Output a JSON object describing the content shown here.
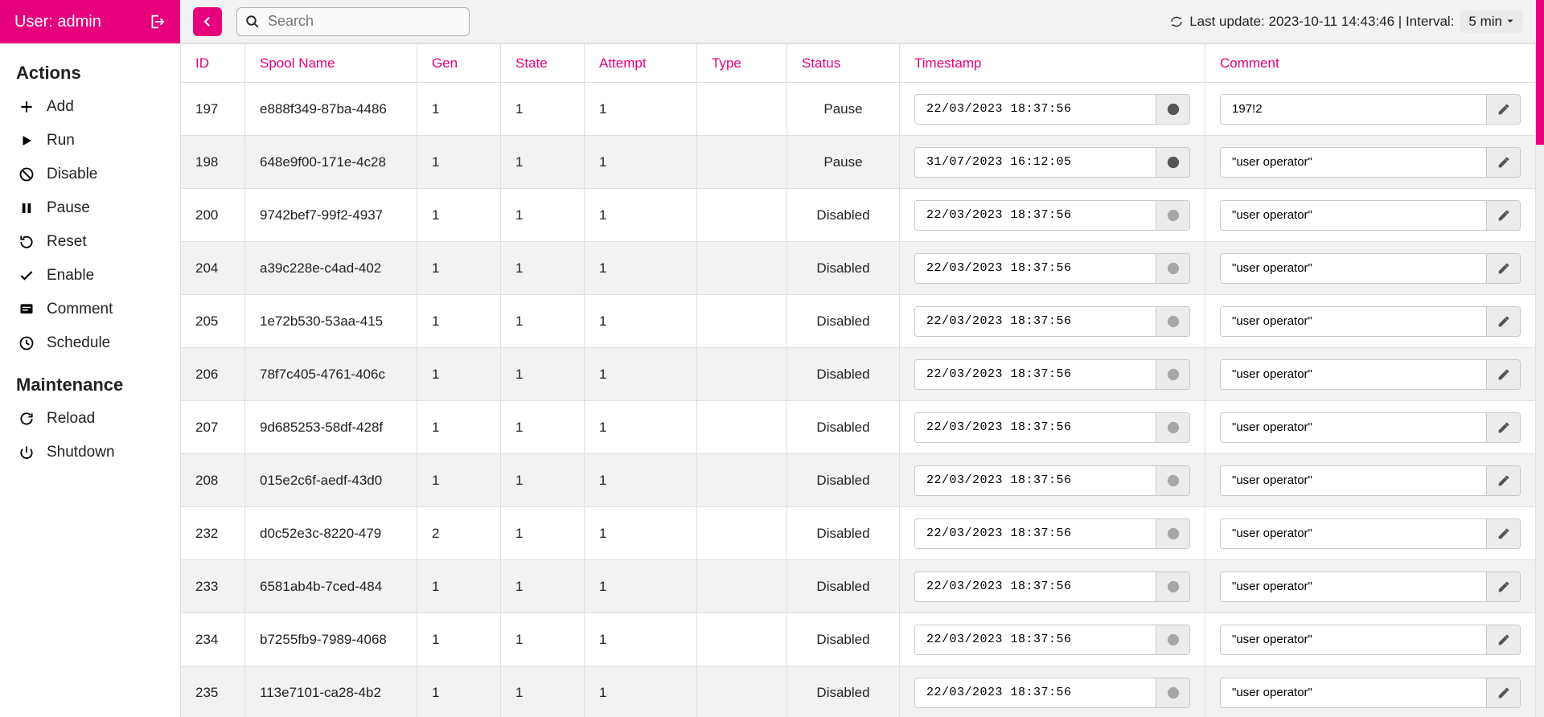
{
  "header": {
    "user_label": "User: admin",
    "search_placeholder": "Search",
    "last_update_label": "Last update: 2023-10-11 14:43:46 | Interval:",
    "interval_value": "5 min"
  },
  "sidebar": {
    "actions_heading": "Actions",
    "maintenance_heading": "Maintenance",
    "actions": [
      {
        "icon": "plus",
        "label": "Add"
      },
      {
        "icon": "play",
        "label": "Run"
      },
      {
        "icon": "nocircle",
        "label": "Disable"
      },
      {
        "icon": "pause",
        "label": "Pause"
      },
      {
        "icon": "reset",
        "label": "Reset"
      },
      {
        "icon": "check",
        "label": "Enable"
      },
      {
        "icon": "comment",
        "label": "Comment"
      },
      {
        "icon": "clock",
        "label": "Schedule"
      }
    ],
    "maintenance": [
      {
        "icon": "reload",
        "label": "Reload"
      },
      {
        "icon": "power",
        "label": "Shutdown"
      }
    ]
  },
  "table": {
    "headers": {
      "id": "ID",
      "name": "Spool Name",
      "gen": "Gen",
      "state": "State",
      "attempt": "Attempt",
      "type": "Type",
      "status": "Status",
      "timestamp": "Timestamp",
      "comment": "Comment"
    },
    "rows": [
      {
        "id": "197",
        "name": "e888f349-87ba-4486",
        "gen": "1",
        "state": "1",
        "attempt": "1",
        "type": "",
        "status": "Pause",
        "ts": "22/03/2023 18:37:56",
        "ts_enabled": true,
        "comment": "197!2"
      },
      {
        "id": "198",
        "name": "648e9f00-171e-4c28",
        "gen": "1",
        "state": "1",
        "attempt": "1",
        "type": "",
        "status": "Pause",
        "ts": "31/07/2023 16:12:05",
        "ts_enabled": true,
        "comment": "\"user operator\""
      },
      {
        "id": "200",
        "name": "9742bef7-99f2-4937",
        "gen": "1",
        "state": "1",
        "attempt": "1",
        "type": "",
        "status": "Disabled",
        "ts": "22/03/2023 18:37:56",
        "ts_enabled": false,
        "comment": "\"user operator\""
      },
      {
        "id": "204",
        "name": "a39c228e-c4ad-402",
        "gen": "1",
        "state": "1",
        "attempt": "1",
        "type": "",
        "status": "Disabled",
        "ts": "22/03/2023 18:37:56",
        "ts_enabled": false,
        "comment": "\"user operator\""
      },
      {
        "id": "205",
        "name": "1e72b530-53aa-415",
        "gen": "1",
        "state": "1",
        "attempt": "1",
        "type": "",
        "status": "Disabled",
        "ts": "22/03/2023 18:37:56",
        "ts_enabled": false,
        "comment": "\"user operator\""
      },
      {
        "id": "206",
        "name": "78f7c405-4761-406c",
        "gen": "1",
        "state": "1",
        "attempt": "1",
        "type": "",
        "status": "Disabled",
        "ts": "22/03/2023 18:37:56",
        "ts_enabled": false,
        "comment": "\"user operator\""
      },
      {
        "id": "207",
        "name": "9d685253-58df-428f",
        "gen": "1",
        "state": "1",
        "attempt": "1",
        "type": "",
        "status": "Disabled",
        "ts": "22/03/2023 18:37:56",
        "ts_enabled": false,
        "comment": "\"user operator\""
      },
      {
        "id": "208",
        "name": "015e2c6f-aedf-43d0",
        "gen": "1",
        "state": "1",
        "attempt": "1",
        "type": "",
        "status": "Disabled",
        "ts": "22/03/2023 18:37:56",
        "ts_enabled": false,
        "comment": "\"user operator\""
      },
      {
        "id": "232",
        "name": "d0c52e3c-8220-479",
        "gen": "2",
        "state": "1",
        "attempt": "1",
        "type": "",
        "status": "Disabled",
        "ts": "22/03/2023 18:37:56",
        "ts_enabled": false,
        "comment": "\"user operator\""
      },
      {
        "id": "233",
        "name": "6581ab4b-7ced-484",
        "gen": "1",
        "state": "1",
        "attempt": "1",
        "type": "",
        "status": "Disabled",
        "ts": "22/03/2023 18:37:56",
        "ts_enabled": false,
        "comment": "\"user operator\""
      },
      {
        "id": "234",
        "name": "b7255fb9-7989-4068",
        "gen": "1",
        "state": "1",
        "attempt": "1",
        "type": "",
        "status": "Disabled",
        "ts": "22/03/2023 18:37:56",
        "ts_enabled": false,
        "comment": "\"user operator\""
      },
      {
        "id": "235",
        "name": "113e7101-ca28-4b2",
        "gen": "1",
        "state": "1",
        "attempt": "1",
        "type": "",
        "status": "Disabled",
        "ts": "22/03/2023 18:37:56",
        "ts_enabled": false,
        "comment": "\"user operator\""
      }
    ]
  }
}
